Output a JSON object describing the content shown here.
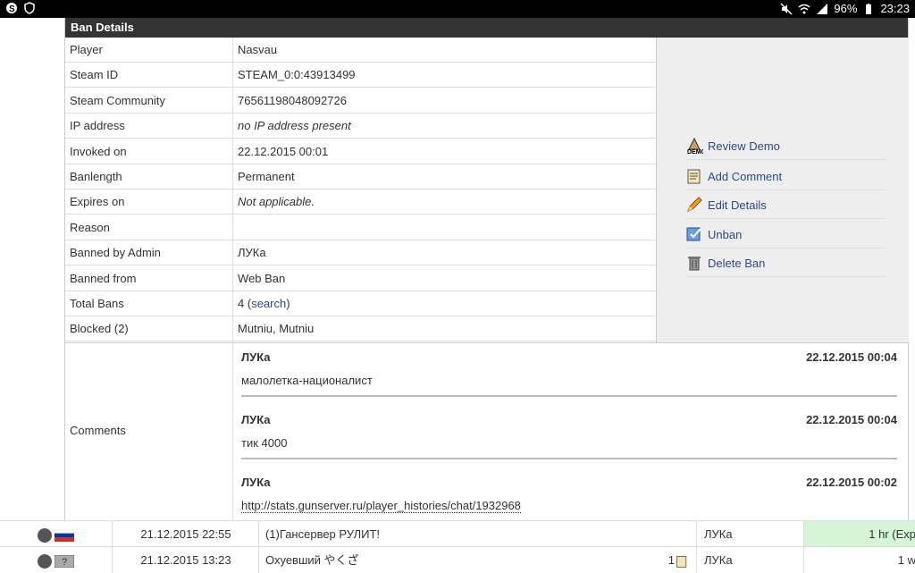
{
  "status_bar": {
    "battery": "96%",
    "time": "23:23"
  },
  "panel": {
    "title": "Ban Details"
  },
  "details": [
    {
      "label": "Player",
      "value": "Nasvau",
      "style": "normal"
    },
    {
      "label": "Steam ID",
      "value": "STEAM_0:0:43913499",
      "style": "normal"
    },
    {
      "label": "Steam Community",
      "value": "76561198048092726",
      "style": "link"
    },
    {
      "label": "IP address",
      "value": "no IP address present",
      "style": "italic"
    },
    {
      "label": "Invoked on",
      "value": "22.12.2015 00:01",
      "style": "normal"
    },
    {
      "label": "Banlength",
      "value": "Permanent",
      "style": "normal"
    },
    {
      "label": "Expires on",
      "value": "Not applicable.",
      "style": "italic"
    },
    {
      "label": "Reason",
      "value": "",
      "style": "normal"
    },
    {
      "label": "Banned by Admin",
      "value": "ЛУКа",
      "style": "normal"
    },
    {
      "label": "Banned from",
      "value": "Web Ban",
      "style": "normal"
    },
    {
      "label": "Total Bans",
      "value": "4",
      "value_link": "search",
      "style": "total"
    },
    {
      "label": "Blocked (2)",
      "value": "Mutniu, Mutniu",
      "style": "normal"
    }
  ],
  "actions": [
    {
      "label": "Review Demo",
      "icon": "demo-icon"
    },
    {
      "label": "Add Comment",
      "icon": "add-comment-icon"
    },
    {
      "label": "Edit Details",
      "icon": "pencil-icon"
    },
    {
      "label": "Unban",
      "icon": "unban-icon"
    },
    {
      "label": "Delete Ban",
      "icon": "trash-icon"
    }
  ],
  "comments": {
    "label": "Comments",
    "items": [
      {
        "author": "ЛУКа",
        "date": "22.12.2015 00:04",
        "text": "малолетка-националист"
      },
      {
        "author": "ЛУКа",
        "date": "22.12.2015 00:04",
        "text": "тик 4000"
      },
      {
        "author": "ЛУКа",
        "date": "22.12.2015 00:02",
        "text": "http://stats.gunserver.ru/player_histories/chat/1932968"
      }
    ]
  },
  "ban_rows": [
    {
      "date": "21.12.2015 22:55",
      "name": "(1)Гансервер РУЛИТ!",
      "comment_count": "",
      "admin": "ЛУКа",
      "length": "1 hr (Exp",
      "flag": "russia-flag-icon",
      "highlight": "#d6f5d6"
    },
    {
      "date": "21.12.2015 13:23",
      "name": "Охуевший やくざ",
      "comment_count": "1",
      "admin": "ЛУКа",
      "length": "1 w",
      "flag": "unknown-flag-icon",
      "highlight": "#ffffff"
    }
  ]
}
